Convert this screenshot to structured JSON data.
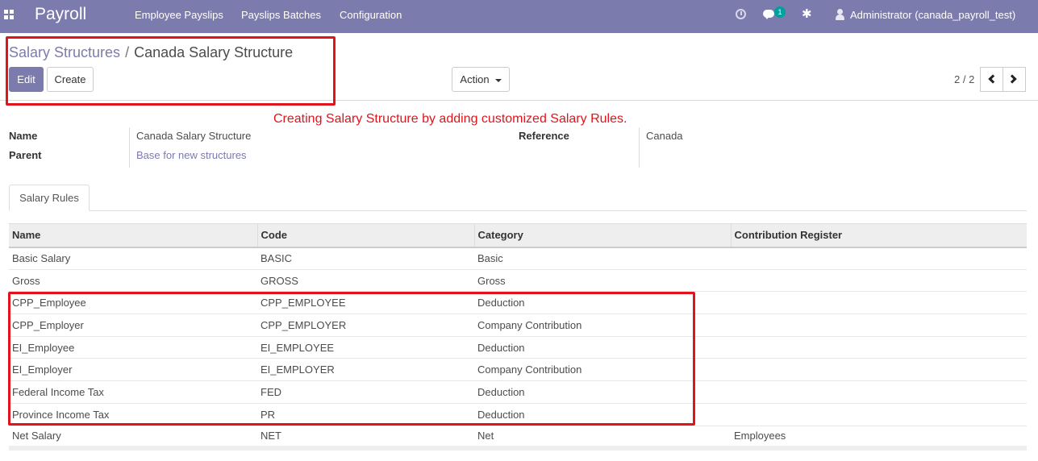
{
  "navbar": {
    "app_name": "Payroll",
    "menu": [
      "Employee Payslips",
      "Payslips Batches",
      "Configuration"
    ],
    "chat_count": "1",
    "user": "Administrator (canada_payroll_test)",
    "bg_color": "#7c7bad"
  },
  "breadcrumb": {
    "parent": "Salary Structures",
    "separator": "/",
    "current": "Canada Salary Structure"
  },
  "buttons": {
    "edit": "Edit",
    "create": "Create",
    "action": "Action"
  },
  "pager": {
    "value": "2 / 2"
  },
  "annotation": {
    "text": "Creating Salary Structure by adding customized Salary Rules.",
    "color": "#e0151c"
  },
  "form": {
    "name_label": "Name",
    "name_value": "Canada Salary Structure",
    "parent_label": "Parent",
    "parent_value": "Base for new structures",
    "reference_label": "Reference",
    "reference_value": "Canada"
  },
  "tabs": [
    "Salary Rules"
  ],
  "table": {
    "columns": [
      "Name",
      "Code",
      "Category",
      "Contribution Register"
    ],
    "rows": [
      [
        "Basic Salary",
        "BASIC",
        "Basic",
        ""
      ],
      [
        "Gross",
        "GROSS",
        "Gross",
        ""
      ],
      [
        "CPP_Employee",
        "CPP_EMPLOYEE",
        "Deduction",
        ""
      ],
      [
        "CPP_Employer",
        "CPP_EMPLOYER",
        "Company Contribution",
        ""
      ],
      [
        "EI_Employee",
        "EI_EMPLOYEE",
        "Deduction",
        ""
      ],
      [
        "EI_Employer",
        "EI_EMPLOYER",
        "Company Contribution",
        ""
      ],
      [
        "Federal Income Tax",
        "FED",
        "Deduction",
        ""
      ],
      [
        "Province Income Tax",
        "PR",
        "Deduction",
        ""
      ],
      [
        "Net Salary",
        "NET",
        "Net",
        "Employees"
      ]
    ]
  }
}
